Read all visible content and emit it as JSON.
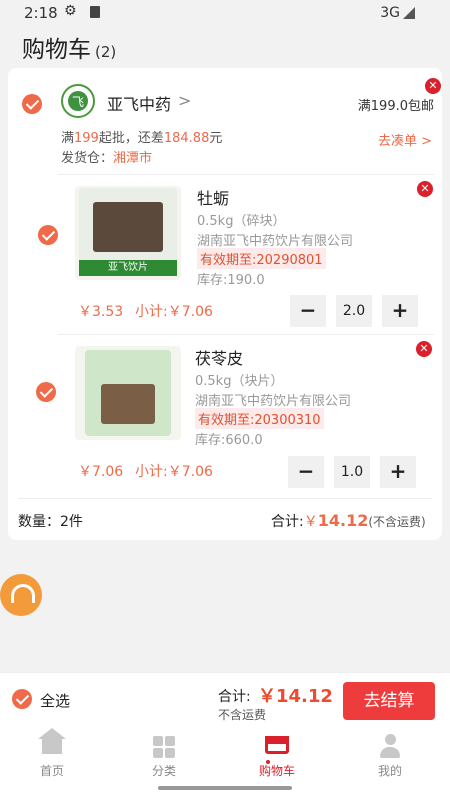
{
  "status_bar": {
    "time": "2:18",
    "network": "3G"
  },
  "header": {
    "title": "购物车",
    "count": "(2)"
  },
  "shop": {
    "name": "亚飞中药",
    "chevron": ">",
    "free_shipping": "满199.0包邮",
    "min_prefix": "满",
    "min_amount": "199",
    "min_middle": "起批，还差",
    "diff_amount": "184.88",
    "min_suffix": "元",
    "coudan": "去凑单 >",
    "warehouse_label": "发货仓：",
    "warehouse_city": "湘潭市"
  },
  "products": [
    {
      "name": "牡蛎",
      "spec": "0.5kg（碎块）",
      "company": "湖南亚飞中药饮片有限公司",
      "expiry": "有效期至:20290801",
      "stock": "库存:190.0",
      "price": "￥3.53",
      "subtotal": "小计:￥7.06",
      "quantity": "2.0",
      "minus": "−",
      "plus": "+",
      "bag_label": "亚飞饮片"
    },
    {
      "name": "茯苓皮",
      "spec": "0.5kg（块片）",
      "company": "湖南亚飞中药饮片有限公司",
      "expiry": "有效期至:20300310",
      "stock": "库存:660.0",
      "price": "￥7.06",
      "subtotal": "小计:￥7.06",
      "quantity": "1.0",
      "minus": "−",
      "plus": "+"
    }
  ],
  "summary": {
    "quantity": "数量：2件",
    "total_label": "合计:",
    "total_currency": "￥",
    "total_amount": "14.12",
    "total_note": "(不含运费)"
  },
  "checkout": {
    "select_all": "全选",
    "total_label": "合计:",
    "total_amount": "￥14.12",
    "no_freight": "不含运费",
    "button": "去结算"
  },
  "tabs": [
    {
      "label": "首页",
      "icon": "home-icon"
    },
    {
      "label": "分类",
      "icon": "category-icon"
    },
    {
      "label": "购物车",
      "icon": "cart-icon",
      "active": true
    },
    {
      "label": "我的",
      "icon": "user-icon"
    }
  ],
  "colors": {
    "accent": "#ee6a48",
    "danger": "#d9202b",
    "checkout": "#ee3b3b",
    "brand_green": "#2f8a34"
  }
}
